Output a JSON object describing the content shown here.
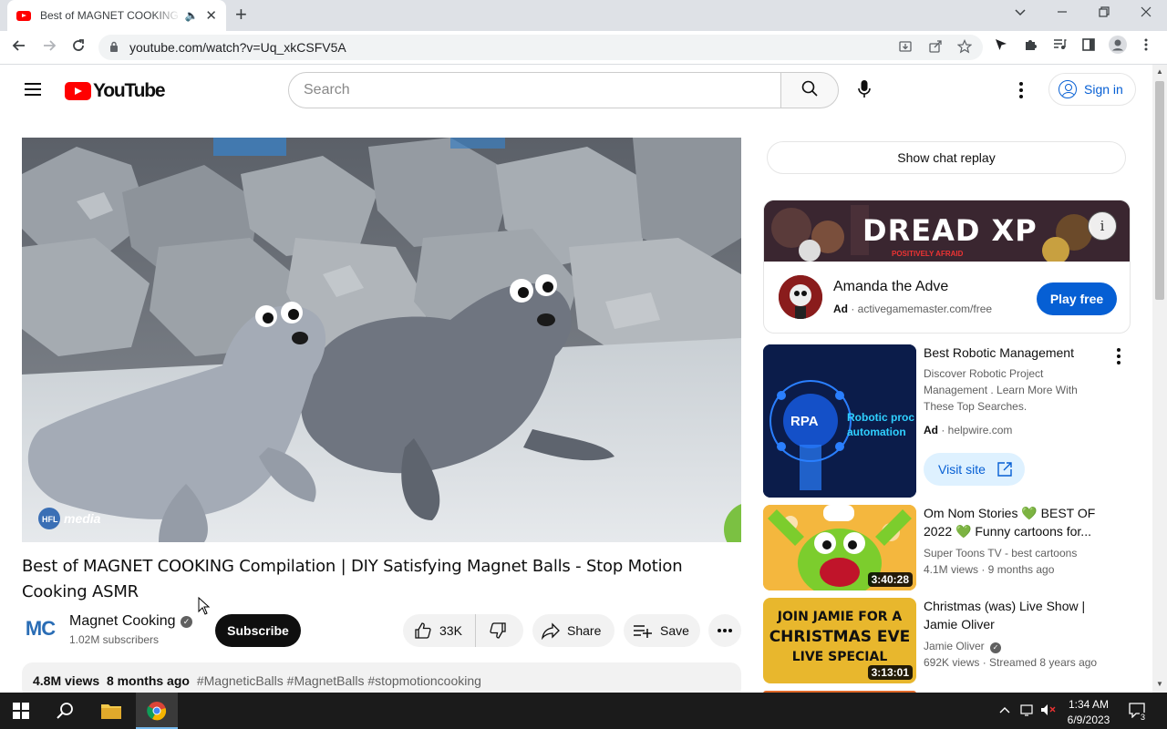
{
  "browser": {
    "tab_title": "Best of MAGNET COOKING C",
    "tab_audio": "🔈",
    "tab_close": "✕",
    "new_tab": "+",
    "url": "youtube.com/watch?v=Uq_xkCSFV5A",
    "window_controls": [
      "chevron-down",
      "minimize",
      "restore",
      "close"
    ]
  },
  "header": {
    "logo_text": "YouTube",
    "search_placeholder": "Search",
    "sign_in_label": "Sign in"
  },
  "video": {
    "player_watermark": "media",
    "title": "Best of MAGNET COOKING Compilation | DIY Satisfying Magnet Balls - Stop Motion Cooking ASMR",
    "channel_name": "Magnet Cooking",
    "channel_avatar_text": "MC",
    "subscribers": "1.02M subscribers",
    "subscribe_label": "Subscribe",
    "likes": "33K",
    "share_label": "Share",
    "save_label": "Save",
    "views": "4.8M views",
    "age": "8 months ago",
    "hashtags": "#MagneticBalls #MagnetBalls #stopmotioncooking"
  },
  "sidebar": {
    "chat_replay_label": "Show chat replay",
    "ad": {
      "banner_text": "DREAD XP",
      "banner_subtext": "POSITIVELY AFRAID",
      "advertiser": "Amanda the Adve",
      "ad_label": "Ad",
      "domain": "activegamemaster.com/free",
      "cta": "Play free"
    },
    "recommendations": [
      {
        "title": "Best Robotic Management",
        "description": "Discover Robotic Project Management . Learn More With These Top Searches.",
        "ad_label": "Ad",
        "domain": "helpwire.com",
        "cta": "Visit site",
        "thumb_text": "RPA",
        "thumb_subtext": "Robotic proc automation"
      },
      {
        "title": "Om Nom Stories 💚 BEST OF 2022 💚 Funny cartoons for...",
        "channel": "Super Toons TV - best cartoons",
        "meta": "4.1M views · 9 months ago",
        "duration": "3:40:28"
      },
      {
        "title": "Christmas (was) Live Show | Jamie Oliver",
        "channel": "Jamie Oliver",
        "meta": "692K views · Streamed 8 years ago",
        "duration": "3:13:01",
        "thumb_lines": [
          "JOIN JAMIE FOR A",
          "CHRISTMAS EVE",
          "LIVE SPECIAL"
        ]
      }
    ]
  },
  "taskbar": {
    "time": "1:34 AM",
    "date": "6/9/2023",
    "notification_count": "3"
  },
  "colors": {
    "youtube_red": "#ff0000",
    "link_blue": "#065fd4",
    "taskbar": "#1b1b1b"
  }
}
